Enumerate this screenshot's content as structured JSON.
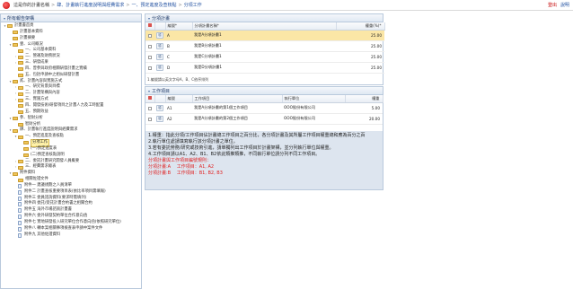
{
  "header": {
    "prefix": "這是你的計畫名稱",
    "crumbs": [
      "肆、計畫執行進度說明與經費需求",
      "一、預定進度及查核點",
      "分項工作"
    ],
    "separator": ">",
    "logout": "登出",
    "help": "說明"
  },
  "tree": {
    "title": "所有報告架構",
    "nodes": [
      {
        "label": "計畫書首頁",
        "depth": 0,
        "arrow": "▾",
        "icon": "folder-open-icon"
      },
      {
        "label": "計畫基本資料",
        "depth": 1,
        "arrow": "",
        "icon": "folder-icon"
      },
      {
        "label": "計畫摘要",
        "depth": 1,
        "arrow": "",
        "icon": "folder-icon"
      },
      {
        "label": "壹、公司概況",
        "depth": 1,
        "arrow": "▾",
        "icon": "folder-icon"
      },
      {
        "label": "一、公司基本資料",
        "depth": 2,
        "arrow": "",
        "icon": "folder-icon"
      },
      {
        "label": "二、營運及財務狀況",
        "depth": 2,
        "arrow": "›",
        "icon": "folder-icon"
      },
      {
        "label": "三、研發成果",
        "depth": 2,
        "arrow": "›",
        "icon": "folder-icon"
      },
      {
        "label": "四、曾參與政府相關研發計畫之實績",
        "depth": 2,
        "arrow": "",
        "icon": "folder-icon"
      },
      {
        "label": "五、包括申請中之相似研發計畫",
        "depth": 2,
        "arrow": "",
        "icon": "folder-icon"
      },
      {
        "label": "貳、計畫內容與實施方式",
        "depth": 1,
        "arrow": "▾",
        "icon": "folder-icon"
      },
      {
        "label": "一、研究背景與目標",
        "depth": 2,
        "arrow": "›",
        "icon": "folder-icon"
      },
      {
        "label": "二、計畫架構與內容",
        "depth": 2,
        "arrow": "›",
        "icon": "folder-icon"
      },
      {
        "label": "三、實施方式",
        "depth": 2,
        "arrow": "›",
        "icon": "folder-icon"
      },
      {
        "label": "四、開發技術/研發項目之計畫人力及工時配置",
        "depth": 2,
        "arrow": "",
        "icon": "folder-icon"
      },
      {
        "label": "五、預期效益",
        "depth": 2,
        "arrow": "",
        "icon": "folder-icon"
      },
      {
        "label": "參、智財分析",
        "depth": 1,
        "arrow": "▾",
        "icon": "folder-icon"
      },
      {
        "label": "智財分析",
        "depth": 2,
        "arrow": "",
        "icon": "folder-icon"
      },
      {
        "label": "肆、計畫執行進度說明與經費需求",
        "depth": 1,
        "arrow": "▾",
        "icon": "folder-icon"
      },
      {
        "label": "一、預定進度及查核點",
        "depth": 2,
        "arrow": "▾",
        "icon": "folder-icon"
      },
      {
        "label": "分項工作",
        "depth": 3,
        "arrow": "",
        "icon": "folder-icon",
        "selected": true
      },
      {
        "label": "(一)預定進度表",
        "depth": 3,
        "arrow": "",
        "icon": "folder-icon"
      },
      {
        "label": "(二)預定查核點說明",
        "depth": 3,
        "arrow": "",
        "icon": "folder-icon"
      },
      {
        "label": "二、委託計畫研究開發人員概要",
        "depth": 2,
        "arrow": "›",
        "icon": "folder-icon"
      },
      {
        "label": "三、經費需求總表",
        "depth": 2,
        "arrow": "›",
        "icon": "folder-icon"
      },
      {
        "label": "附件資料",
        "depth": 1,
        "arrow": "▾",
        "icon": "folder-icon"
      },
      {
        "label": "相關佐證文件",
        "depth": 2,
        "arrow": "",
        "icon": "folder-icon"
      },
      {
        "label": "附件一 建議規劃之人員清單",
        "depth": 2,
        "arrow": "",
        "icon": "page-icon"
      },
      {
        "label": "附件二 計畫查核重要項目表(依比率項目需填報)",
        "depth": 2,
        "arrow": "",
        "icon": "page-icon"
      },
      {
        "label": "附件三 委員諮詢資料(要求時需填列)",
        "depth": 2,
        "arrow": "",
        "icon": "page-icon"
      },
      {
        "label": "附件四 委託/受託計畫合約書之相關合約",
        "depth": 2,
        "arrow": "",
        "icon": "page-icon"
      },
      {
        "label": "附件五 海外市場諮詢計畫書",
        "depth": 2,
        "arrow": "",
        "icon": "page-icon"
      },
      {
        "label": "附件六 委外研發契約單位合作意向函",
        "depth": 2,
        "arrow": "",
        "icon": "page-icon"
      },
      {
        "label": "附件七 實地研發投入研究單位合作意向函(依照研究單位)",
        "depth": 2,
        "arrow": "",
        "icon": "page-icon"
      },
      {
        "label": "附件八 轉本案相關事項檢查表申請中案件文件",
        "depth": 2,
        "arrow": "",
        "icon": "page-icon"
      },
      {
        "label": "附件九 其他佐證資料",
        "depth": 2,
        "arrow": "",
        "icon": "page-icon"
      }
    ]
  },
  "panel1": {
    "title": "分項計畫",
    "columns": [
      "",
      "",
      "編號*",
      "分項計畫名稱*",
      "權重(%)*"
    ],
    "rows": [
      {
        "btn": "檢",
        "code": "A",
        "name": "我是A分項計畫1",
        "weight": "25.00",
        "highlight": true
      },
      {
        "btn": "檢",
        "code": "B",
        "name": "我是B分項計畫1",
        "weight": "25.00"
      },
      {
        "btn": "檢",
        "code": "C",
        "name": "我是C分項計畫1",
        "weight": "25.00"
      },
      {
        "btn": "檢",
        "code": "D",
        "name": "我是D分項計畫1",
        "weight": "25.00"
      }
    ],
    "footnote": "1.編號請以英文字母A、B、C依序排列"
  },
  "panel2": {
    "title": "工作項目",
    "columns": [
      "",
      "",
      "編號",
      "工作項目",
      "執行單位",
      "權重"
    ],
    "rows": [
      {
        "btn": "檢",
        "code": "A1",
        "name": "我是A分項計畫的第1個工作項目",
        "unit": "OOO股份有限公司",
        "weight": "5.00"
      },
      {
        "btn": "檢",
        "code": "A2",
        "name": "我是A分項計畫的第2個工作項目",
        "unit": "OOO股份有限公司",
        "weight": "20.00"
      }
    ]
  },
  "notes": {
    "lines": [
      "1.權重：指此分項/工作項目佔計畫總工作項目之百分比，各分項計畫及其所屬工作項目權重總和應為百分之百",
      "2.執行單位處請填寫執行該分項計畫之單位。",
      "3.若有委託勞務/研究或技術引進，請單獨列出工作項目於計畫架構，並分列執行單位與權重。",
      "4.工作項目請以A1、A2、B1、B2依此類推類推，不同執行單位請分列不同工作項目。"
    ],
    "red_lines": [
      "分項計畫與工作項目編號規則：",
      "分項計畫:A　 工作項目：A1, A2",
      "分項計畫:B　 工作項目：B1, B2, B3"
    ]
  }
}
